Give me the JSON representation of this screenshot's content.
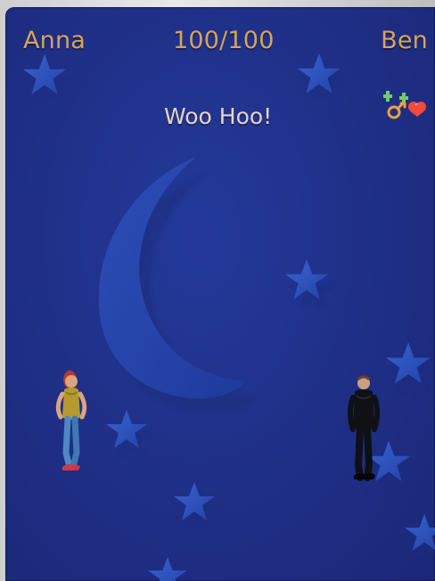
{
  "hud": {
    "left_name": "Anna",
    "score": "100/100",
    "right_name": "Ben"
  },
  "message": "Woo Hoo!",
  "icons": {
    "mood": "couple-love-icon",
    "moon": "crescent-moon",
    "stars": "star"
  },
  "characters": [
    {
      "name": "anna",
      "side": "left"
    },
    {
      "name": "ben",
      "side": "right"
    }
  ],
  "colors": {
    "background": "#1f2f86",
    "hud_text": "#d7a35a",
    "message_text": "#e7d2c7",
    "moon": "#243fa6",
    "star": "#2f55c8"
  }
}
